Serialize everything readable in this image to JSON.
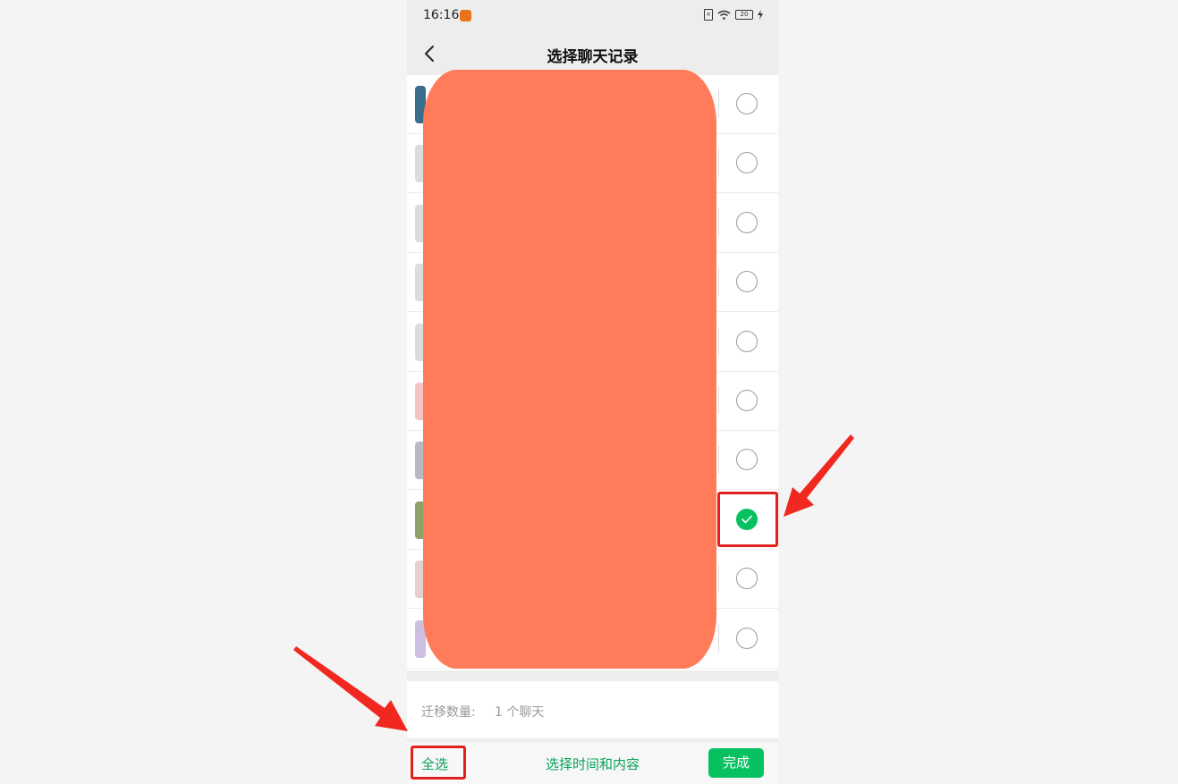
{
  "status_bar": {
    "time": "16:16",
    "battery": "20"
  },
  "header": {
    "title": "选择聊天记录"
  },
  "rows": [
    {
      "selected": false
    },
    {
      "selected": false
    },
    {
      "selected": false
    },
    {
      "selected": false
    },
    {
      "selected": false
    },
    {
      "selected": false
    },
    {
      "selected": false
    },
    {
      "selected": true
    },
    {
      "selected": false
    },
    {
      "selected": false
    }
  ],
  "summary": {
    "label": "迁移数量:",
    "value": "1 个聊天"
  },
  "bottom_bar": {
    "select_all": "全选",
    "select_time": "选择时间和内容",
    "done": "完成"
  },
  "colors": {
    "accent": "#07c160",
    "redaction": "#ff7b5a",
    "annotation": "#e4201c"
  }
}
